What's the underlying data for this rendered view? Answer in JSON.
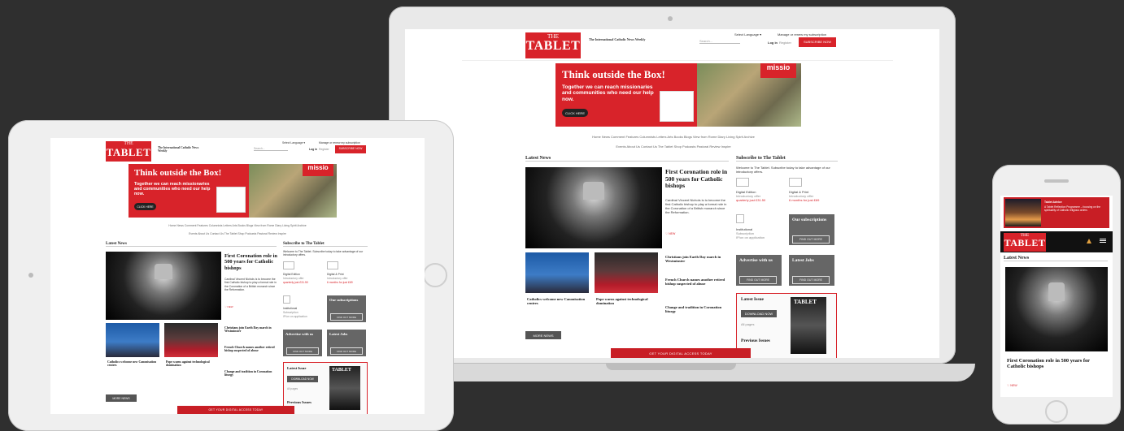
{
  "site": {
    "logo_small": "THE",
    "logo_big": "TABLET",
    "tagline": "The International Catholic News Weekly",
    "select_language": "Select Language ▾",
    "manage_subscription": "Manage or renew my subscription",
    "search_placeholder": "Search...",
    "login": "Log in",
    "register": "Register",
    "subscribe_now": "SUBSCRIBE NOW"
  },
  "banner": {
    "headline": "Think outside the Box!",
    "text": "Together we can reach missionaries and communities who need our help now.",
    "cta": "CLICK HERE",
    "brand": "missio",
    "brand_tagline": "Today. Tomorrow. Together."
  },
  "nav": {
    "row1": "Home   News   Comment   Features   Columnists   Letters   Arts   Books   Blogs   View from Rome   Diary   Living Spirit   Archive",
    "row2": "Events   About Us   Contact Us   The Tablet Shop   Podcasts   Pastoral Review   Inspire"
  },
  "latest_news": {
    "title": "Latest News",
    "lead_headline": "First Coronation role in 500 years for Catholic bishops",
    "lead_text": "Cardinal Vincent Nichols is to become the first Catholic bishop to play a formal role in the Coronation of a British monarch since the Reformation.",
    "lead_meta": "♡ NEW",
    "story2": "Catholics welcome new Canonisation centres",
    "story3": "Pope warns against technological domination",
    "story4": "Christians join Earth Day march in Westminster",
    "story5": "French Church names another retired bishop suspected of abuse",
    "story6": "Change and tradition in Coronation liturgy",
    "more_news": "MORE NEWS"
  },
  "subscribe": {
    "title": "Subscribe to The Tablet",
    "intro": "Welcome to The Tablet. Subscribe today to take advantage of our introductory offers.",
    "digital_edition": "Digital Edition",
    "digital_offer": "Introductory offer",
    "digital_price": "quarterly just £31.50",
    "digital_print": "Digital & Print",
    "digital_print_offer": "Introductory offer",
    "digital_print_price": "6 months for just £69",
    "institutional": "Institutional",
    "institutional_sub": "Subscription",
    "institutional_price": "IP/on on application",
    "our_subscriptions": "Our subscriptions",
    "advertise": "Advertise with us",
    "latest_jobs": "Latest Jobs",
    "find_out_more": "FIND OUT MORE",
    "latest_issue": "Latest Issue",
    "download_now": "DOWNLOAD NOW",
    "all_pages": "All pages",
    "previous_issues": "Previous Issues",
    "cover_title": "TABLET"
  },
  "digital_access_bar": "GET YOUR DIGITAL ACCESS TODAY",
  "phone": {
    "promo_title": "Tablet Advice",
    "promo_text": "A Tablet Reflection Programme – focusing on the spirituality of Catholic religious orders",
    "latest_news": "Latest News",
    "headline": "First Coronation role in 500 years for Catholic bishops",
    "meta": "♡ NEW"
  }
}
